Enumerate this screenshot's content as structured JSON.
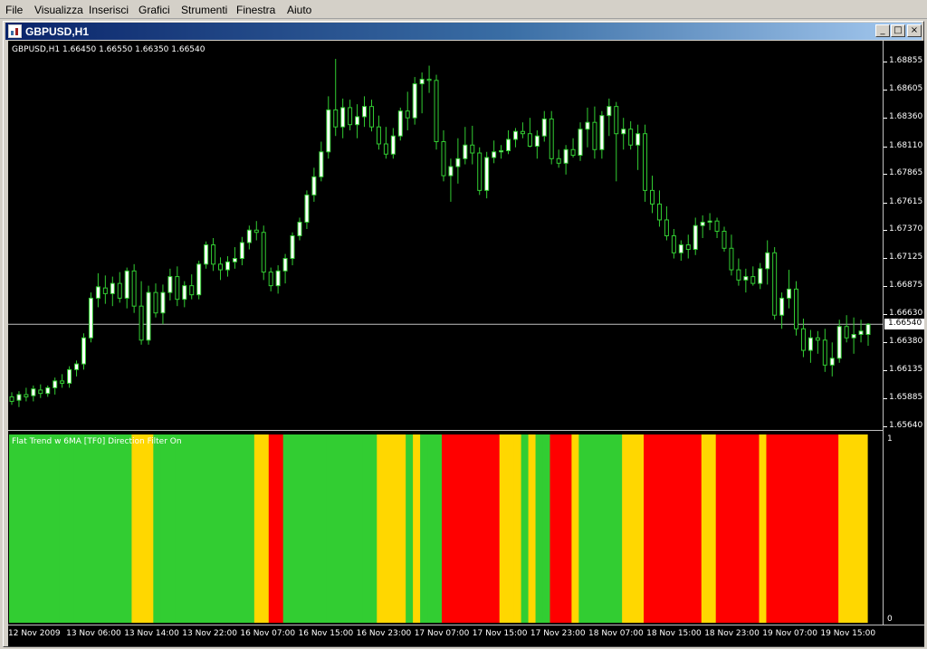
{
  "menu": [
    "File",
    "Visualizza",
    "Inserisci",
    "Grafici",
    "Strumenti",
    "Finestra",
    "Aiuto"
  ],
  "window": {
    "title": "GBPUSD,H1",
    "min_glyph": "_",
    "max_glyph": "□",
    "close_glyph": "×"
  },
  "chart": {
    "symbol_line": "GBPUSD,H1  1.66450 1.66550 1.66350 1.66540",
    "current_price": "1.66540",
    "price_ticks": [
      "1.68855",
      "1.68605",
      "1.68360",
      "1.68110",
      "1.67865",
      "1.67615",
      "1.67370",
      "1.67125",
      "1.66875",
      "1.66630",
      "1.66380",
      "1.66135",
      "1.65885",
      "1.65640"
    ],
    "time_labels": [
      "12 Nov 2009",
      "13 Nov 06:00",
      "13 Nov 14:00",
      "13 Nov 22:00",
      "16 Nov 07:00",
      "16 Nov 15:00",
      "16 Nov 23:00",
      "17 Nov 07:00",
      "17 Nov 15:00",
      "17 Nov 23:00",
      "18 Nov 07:00",
      "18 Nov 15:00",
      "18 Nov 23:00",
      "19 Nov 07:00",
      "19 Nov 15:00"
    ],
    "candle_color": "#ffffff",
    "wick_color": "#32cd32",
    "bg_color": "#000000"
  },
  "indicator": {
    "label": "Flat Trend w 6MA [TF0]  Direction Filter On",
    "scale_hi": "1",
    "scale_lo": "0",
    "colors": {
      "g": "#32cd32",
      "y": "#ffd700",
      "r": "#ff0000"
    },
    "bands": [
      "g",
      "g",
      "g",
      "g",
      "g",
      "g",
      "g",
      "g",
      "g",
      "g",
      "g",
      "g",
      "g",
      "g",
      "g",
      "g",
      "g",
      "y",
      "y",
      "y",
      "g",
      "g",
      "g",
      "g",
      "g",
      "g",
      "g",
      "g",
      "g",
      "g",
      "g",
      "g",
      "g",
      "g",
      "y",
      "y",
      "r",
      "r",
      "g",
      "g",
      "g",
      "g",
      "g",
      "g",
      "g",
      "g",
      "g",
      "g",
      "g",
      "g",
      "g",
      "y",
      "y",
      "y",
      "y",
      "g",
      "y",
      "g",
      "g",
      "g",
      "r",
      "r",
      "r",
      "r",
      "r",
      "r",
      "r",
      "r",
      "y",
      "y",
      "y",
      "g",
      "y",
      "g",
      "g",
      "r",
      "r",
      "r",
      "y",
      "g",
      "g",
      "g",
      "g",
      "g",
      "g",
      "y",
      "y",
      "y",
      "r",
      "r",
      "r",
      "r",
      "r",
      "r",
      "r",
      "r",
      "y",
      "y",
      "r",
      "r",
      "r",
      "r",
      "r",
      "r",
      "y",
      "r",
      "r",
      "r",
      "r",
      "r",
      "r",
      "r",
      "r",
      "r",
      "r",
      "y",
      "y",
      "y",
      "y"
    ]
  },
  "chart_data": {
    "type": "candlestick",
    "title": "GBPUSD,H1",
    "ylim": [
      1.6564,
      1.6896
    ],
    "candles": [
      [
        1.659,
        1.6594,
        1.6583,
        1.6586
      ],
      [
        1.6587,
        1.6595,
        1.6581,
        1.6592
      ],
      [
        1.6592,
        1.6598,
        1.6586,
        1.659
      ],
      [
        1.6591,
        1.66,
        1.6586,
        1.6597
      ],
      [
        1.6596,
        1.6601,
        1.6589,
        1.6593
      ],
      [
        1.6593,
        1.66,
        1.659,
        1.6598
      ],
      [
        1.6598,
        1.6607,
        1.6592,
        1.6604
      ],
      [
        1.6604,
        1.661,
        1.6598,
        1.6602
      ],
      [
        1.6602,
        1.6617,
        1.6598,
        1.6614
      ],
      [
        1.6614,
        1.6622,
        1.6608,
        1.6619
      ],
      [
        1.6619,
        1.6646,
        1.6614,
        1.6642
      ],
      [
        1.6642,
        1.6682,
        1.6638,
        1.6677
      ],
      [
        1.6677,
        1.6699,
        1.6669,
        1.6687
      ],
      [
        1.6686,
        1.6697,
        1.6672,
        1.6681
      ],
      [
        1.6681,
        1.6696,
        1.667,
        1.669
      ],
      [
        1.669,
        1.67,
        1.6673,
        1.6677
      ],
      [
        1.6677,
        1.6704,
        1.6668,
        1.6701
      ],
      [
        1.6701,
        1.6707,
        1.6664,
        1.667
      ],
      [
        1.667,
        1.6692,
        1.6636,
        1.664
      ],
      [
        1.664,
        1.6688,
        1.6636,
        1.6682
      ],
      [
        1.6682,
        1.669,
        1.666,
        1.6664
      ],
      [
        1.6664,
        1.6689,
        1.6654,
        1.6682
      ],
      [
        1.6682,
        1.6703,
        1.6675,
        1.6696
      ],
      [
        1.6696,
        1.6705,
        1.667,
        1.6676
      ],
      [
        1.6676,
        1.6692,
        1.6669,
        1.6688
      ],
      [
        1.6688,
        1.6698,
        1.6676,
        1.668
      ],
      [
        1.668,
        1.671,
        1.6676,
        1.6707
      ],
      [
        1.6707,
        1.6727,
        1.6703,
        1.6724
      ],
      [
        1.6724,
        1.673,
        1.6701,
        1.6707
      ],
      [
        1.6707,
        1.6713,
        1.6693,
        1.6702
      ],
      [
        1.6702,
        1.6714,
        1.6696,
        1.6709
      ],
      [
        1.6709,
        1.6722,
        1.6703,
        1.6712
      ],
      [
        1.6712,
        1.6731,
        1.6706,
        1.6726
      ],
      [
        1.6726,
        1.6741,
        1.672,
        1.6737
      ],
      [
        1.6737,
        1.6745,
        1.6728,
        1.6735
      ],
      [
        1.6735,
        1.6741,
        1.6693,
        1.67
      ],
      [
        1.67,
        1.6704,
        1.6683,
        1.6688
      ],
      [
        1.6688,
        1.6706,
        1.6681,
        1.6701
      ],
      [
        1.6701,
        1.6716,
        1.669,
        1.6712
      ],
      [
        1.6712,
        1.6735,
        1.6706,
        1.6732
      ],
      [
        1.6732,
        1.6748,
        1.6728,
        1.6744
      ],
      [
        1.6744,
        1.6772,
        1.6738,
        1.6768
      ],
      [
        1.6768,
        1.6792,
        1.6762,
        1.6784
      ],
      [
        1.6784,
        1.6815,
        1.678,
        1.6806
      ],
      [
        1.6806,
        1.6855,
        1.68,
        1.6843
      ],
      [
        1.6843,
        1.6888,
        1.682,
        1.6828
      ],
      [
        1.6828,
        1.6853,
        1.6818,
        1.6845
      ],
      [
        1.6845,
        1.6852,
        1.6825,
        1.683
      ],
      [
        1.683,
        1.6848,
        1.6818,
        1.6837
      ],
      [
        1.6837,
        1.6855,
        1.6828,
        1.6846
      ],
      [
        1.6846,
        1.6852,
        1.6824,
        1.6828
      ],
      [
        1.6828,
        1.6838,
        1.6808,
        1.6813
      ],
      [
        1.6813,
        1.6828,
        1.68,
        1.6804
      ],
      [
        1.6804,
        1.6827,
        1.68,
        1.682
      ],
      [
        1.682,
        1.6845,
        1.6816,
        1.6842
      ],
      [
        1.6842,
        1.6859,
        1.6825,
        1.6836
      ],
      [
        1.6836,
        1.6872,
        1.683,
        1.6866
      ],
      [
        1.6866,
        1.6876,
        1.684,
        1.687
      ],
      [
        1.687,
        1.6882,
        1.6858,
        1.6869
      ],
      [
        1.6869,
        1.6874,
        1.6808,
        1.6815
      ],
      [
        1.6815,
        1.6825,
        1.678,
        1.6785
      ],
      [
        1.6785,
        1.68,
        1.6762,
        1.6793
      ],
      [
        1.6793,
        1.6818,
        1.6778,
        1.68
      ],
      [
        1.68,
        1.6828,
        1.6795,
        1.6812
      ],
      [
        1.6812,
        1.6829,
        1.6795,
        1.6805
      ],
      [
        1.6805,
        1.681,
        1.6768,
        1.6772
      ],
      [
        1.6772,
        1.6806,
        1.6765,
        1.6801
      ],
      [
        1.6801,
        1.6816,
        1.6796,
        1.6806
      ],
      [
        1.6806,
        1.6812,
        1.68,
        1.6807
      ],
      [
        1.6807,
        1.6825,
        1.6804,
        1.6817
      ],
      [
        1.6817,
        1.6827,
        1.681,
        1.6824
      ],
      [
        1.6824,
        1.6832,
        1.6818,
        1.6822
      ],
      [
        1.6822,
        1.6836,
        1.681,
        1.6811
      ],
      [
        1.6811,
        1.6825,
        1.68,
        1.682
      ],
      [
        1.682,
        1.6842,
        1.6815,
        1.6835
      ],
      [
        1.6835,
        1.6842,
        1.6795,
        1.68
      ],
      [
        1.68,
        1.6808,
        1.6792,
        1.6796
      ],
      [
        1.6796,
        1.6812,
        1.6786,
        1.6808
      ],
      [
        1.6808,
        1.6818,
        1.6801,
        1.6803
      ],
      [
        1.6803,
        1.6832,
        1.6798,
        1.6826
      ],
      [
        1.6826,
        1.6845,
        1.681,
        1.6832
      ],
      [
        1.6832,
        1.6846,
        1.68,
        1.6808
      ],
      [
        1.6808,
        1.6842,
        1.68,
        1.6838
      ],
      [
        1.6838,
        1.6853,
        1.682,
        1.6846
      ],
      [
        1.6846,
        1.685,
        1.678,
        1.6822
      ],
      [
        1.6822,
        1.6836,
        1.6808,
        1.6826
      ],
      [
        1.6826,
        1.6833,
        1.6808,
        1.6812
      ],
      [
        1.6812,
        1.683,
        1.679,
        1.6822
      ],
      [
        1.6822,
        1.683,
        1.6762,
        1.6772
      ],
      [
        1.6772,
        1.6785,
        1.6752,
        1.676
      ],
      [
        1.676,
        1.6772,
        1.674,
        1.6746
      ],
      [
        1.6746,
        1.6758,
        1.6728,
        1.6732
      ],
      [
        1.6732,
        1.6738,
        1.6712,
        1.6717
      ],
      [
        1.6717,
        1.6728,
        1.671,
        1.6724
      ],
      [
        1.6724,
        1.6733,
        1.6712,
        1.672
      ],
      [
        1.672,
        1.6748,
        1.6715,
        1.6741
      ],
      [
        1.6741,
        1.675,
        1.673,
        1.6744
      ],
      [
        1.6744,
        1.6752,
        1.6737,
        1.6745
      ],
      [
        1.6745,
        1.6748,
        1.673,
        1.6736
      ],
      [
        1.6736,
        1.674,
        1.6718,
        1.6721
      ],
      [
        1.6721,
        1.6733,
        1.6697,
        1.6702
      ],
      [
        1.6702,
        1.6712,
        1.6688,
        1.6693
      ],
      [
        1.6693,
        1.6703,
        1.6682,
        1.6696
      ],
      [
        1.6696,
        1.6705,
        1.6688,
        1.669
      ],
      [
        1.669,
        1.6708,
        1.6685,
        1.6703
      ],
      [
        1.6703,
        1.6728,
        1.6689,
        1.6717
      ],
      [
        1.6717,
        1.6722,
        1.6658,
        1.6662
      ],
      [
        1.6662,
        1.6682,
        1.665,
        1.6677
      ],
      [
        1.6677,
        1.6702,
        1.6668,
        1.6685
      ],
      [
        1.6685,
        1.6692,
        1.6644,
        1.665
      ],
      [
        1.665,
        1.6659,
        1.6625,
        1.6631
      ],
      [
        1.6631,
        1.6649,
        1.662,
        1.6642
      ],
      [
        1.6642,
        1.6648,
        1.6628,
        1.664
      ],
      [
        1.664,
        1.665,
        1.6612,
        1.6618
      ],
      [
        1.6618,
        1.6638,
        1.6608,
        1.6624
      ],
      [
        1.6624,
        1.6658,
        1.662,
        1.6652
      ],
      [
        1.6652,
        1.6662,
        1.6638,
        1.6642
      ],
      [
        1.6642,
        1.666,
        1.6628,
        1.6645
      ],
      [
        1.6645,
        1.6658,
        1.6638,
        1.6648
      ],
      [
        1.6645,
        1.6655,
        1.6635,
        1.6654
      ]
    ]
  }
}
